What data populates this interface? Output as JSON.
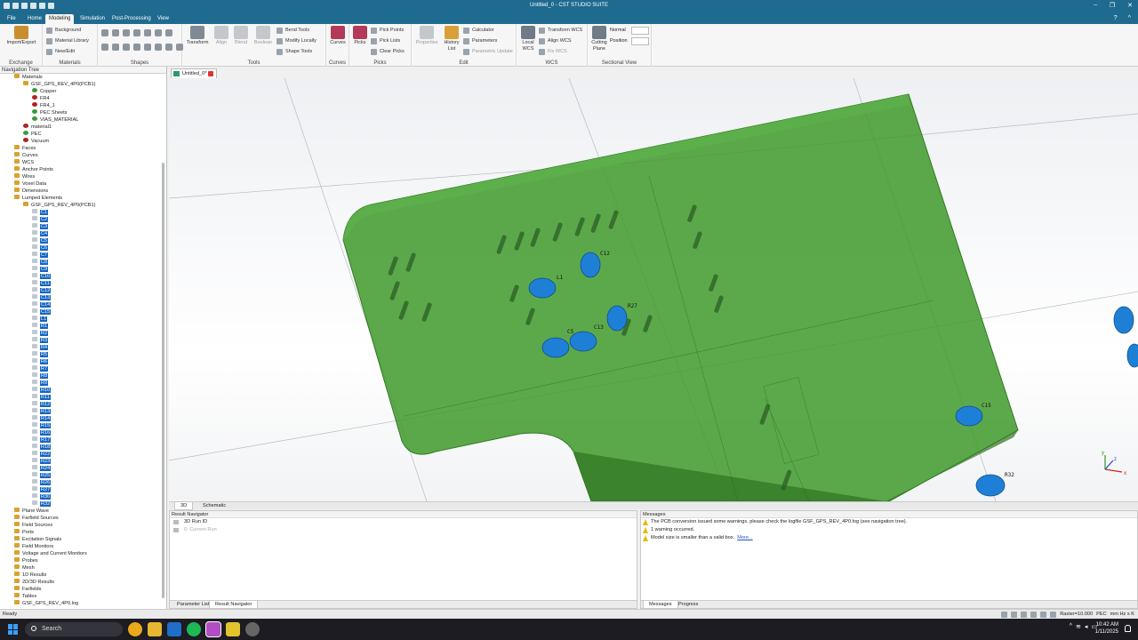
{
  "window": {
    "title": "Untitled_0 - CST STUDIO SUITE",
    "controls": [
      "‒",
      "❐",
      "✕"
    ]
  },
  "menu": {
    "tabs": [
      "File",
      "Home",
      "Modeling",
      "Simulation",
      "Post-Processing",
      "View"
    ],
    "active": "Modeling"
  },
  "ribbon": {
    "exchange": {
      "import_export": "Import/Export",
      "group": "Exchange"
    },
    "materials": {
      "background": "Background",
      "library": "Material Library",
      "new_edit": "New/Edit",
      "group": "Materials"
    },
    "shapes": {
      "group": "Shapes"
    },
    "tools": {
      "transform": "Transform",
      "align": "Align",
      "blend": "Blend",
      "boolean": "Boolean",
      "bend_tools": "Bend Tools",
      "modify_locally": "Modify Locally",
      "shape_tools": "Shape Tools",
      "group": "Tools"
    },
    "curves": {
      "curves": "Curves",
      "group": "Curves"
    },
    "picks": {
      "picks": "Picks",
      "pick_points": "Pick Points",
      "pick_lists": "Pick Lists",
      "clear_picks": "Clear Picks",
      "group": "Picks"
    },
    "edit": {
      "properties": "Properties",
      "history_list": "History List",
      "calculator": "Calculator",
      "parameters": "Parameters",
      "parametric_update": "Parametric Update",
      "group": "Edit"
    },
    "wcs": {
      "local_wcs": "Local WCS",
      "transform_wcs": "Transform WCS",
      "align_wcs": "Align WCS",
      "fix_wcs": "Fix WCS",
      "group": "WCS"
    },
    "sectional": {
      "cutting_plane": "Cutting Plane",
      "normal": "Normal",
      "position": "Position",
      "group": "Sectional View"
    }
  },
  "document_tab": "Untitled_0*",
  "navtree": {
    "header": "Navigation Tree",
    "materials": {
      "label": "Materials",
      "pcb_folder": "GSF_GPS_REV_4P0(PCB1)",
      "pcb_materials": [
        {
          "name": "Copper",
          "color": "#3a9a3a"
        },
        {
          "name": "FR4",
          "color": "#b22222"
        },
        {
          "name": "FR4_1",
          "color": "#b22222"
        },
        {
          "name": "PEC Sheets",
          "color": "#3a9a3a"
        },
        {
          "name": "VIAS_MATERIAL",
          "color": "#3a9a3a"
        }
      ],
      "others": [
        {
          "name": "material1",
          "color": "#b22222"
        },
        {
          "name": "PEC",
          "color": "#3a9a3a"
        },
        {
          "name": "Vacuum",
          "color": "#b22222"
        }
      ]
    },
    "mid_items": [
      "Faces",
      "Curves",
      "WCS",
      "Anchor Points",
      "Wires",
      "Voxel Data",
      "Dimensions"
    ],
    "lumped": {
      "label": "Lumped Elements",
      "folder": "GSF_GPS_REV_4P0(PCB1)",
      "elements": [
        "C1",
        "C2",
        "C3",
        "C4",
        "C5",
        "C6",
        "C7",
        "C8",
        "C9",
        "C10",
        "C11",
        "C12",
        "C13",
        "C14",
        "C15",
        "L1",
        "R1",
        "R2",
        "R3",
        "R4",
        "R5",
        "R6",
        "R7",
        "R8",
        "R9",
        "R10",
        "R11",
        "R12",
        "R13",
        "R14",
        "R15",
        "R16",
        "R17",
        "R18",
        "R22",
        "R23",
        "R24",
        "R25",
        "R26",
        "R27",
        "R30",
        "R32"
      ]
    },
    "bottom_items": [
      "Plane Wave",
      "Farfield Sources",
      "Field Sources",
      "Ports",
      "Excitation Signals",
      "Field Monitors",
      "Voltage and Current Monitors",
      "Probes",
      "Mesh",
      "1D Results",
      "2D/3D Results",
      "Farfields",
      "Tables",
      "GSF_GPS_REV_4P0.log"
    ]
  },
  "viewport": {
    "component_labels": [
      "L1",
      "C12",
      "R27",
      "C5",
      "C13",
      "C15",
      "R32"
    ],
    "board_color": "#3f9a2c"
  },
  "view_tabs": [
    "3D",
    "Schematic"
  ],
  "result_navigator": {
    "title": "Result Navigator",
    "rows": [
      "3D Run ID",
      "0: Current Run"
    ],
    "tabs": [
      "Parameter List",
      "Result Navigator"
    ]
  },
  "messages": {
    "title": "Messages",
    "items": [
      "The PCB conversion issued some warnings, please check the logfile GSF_GPS_REV_4P0.log (see navigation tree).",
      "1 warning occurred.",
      "Model size is smaller than a valid box."
    ],
    "more_link": "More...",
    "tabs": [
      "Messages",
      "Progress"
    ]
  },
  "statusbar": {
    "ready": "Ready",
    "raster": "Raster=10.000",
    "pec": "PEC",
    "units": "mm  Hz  s  K"
  },
  "taskbar": {
    "search": "Search",
    "time": "10:42 AM",
    "date": "1/11/2025"
  }
}
